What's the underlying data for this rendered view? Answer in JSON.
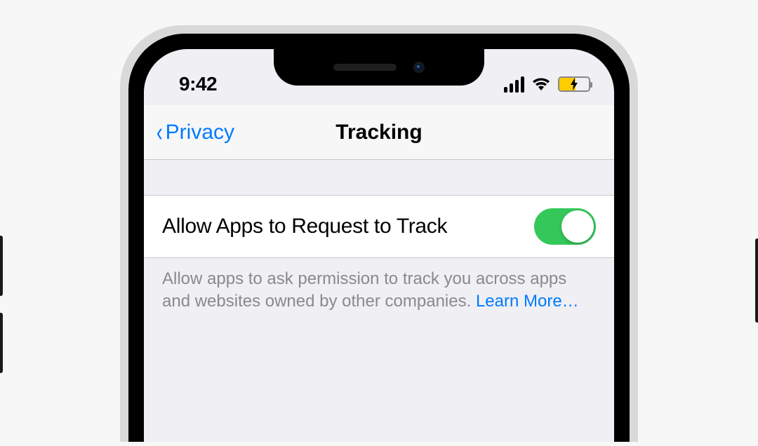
{
  "statusbar": {
    "time": "9:42"
  },
  "nav": {
    "back_label": "Privacy",
    "title": "Tracking"
  },
  "settings": {
    "row_label": "Allow Apps to Request to Track",
    "toggle_state": "on",
    "footer_text": "Allow apps to ask permission to track you across apps and websites owned by other companies. ",
    "learn_more_label": "Learn More…"
  },
  "colors": {
    "ios_blue": "#007aff",
    "toggle_green": "#34c759",
    "battery_yellow": "#ffcc00"
  }
}
